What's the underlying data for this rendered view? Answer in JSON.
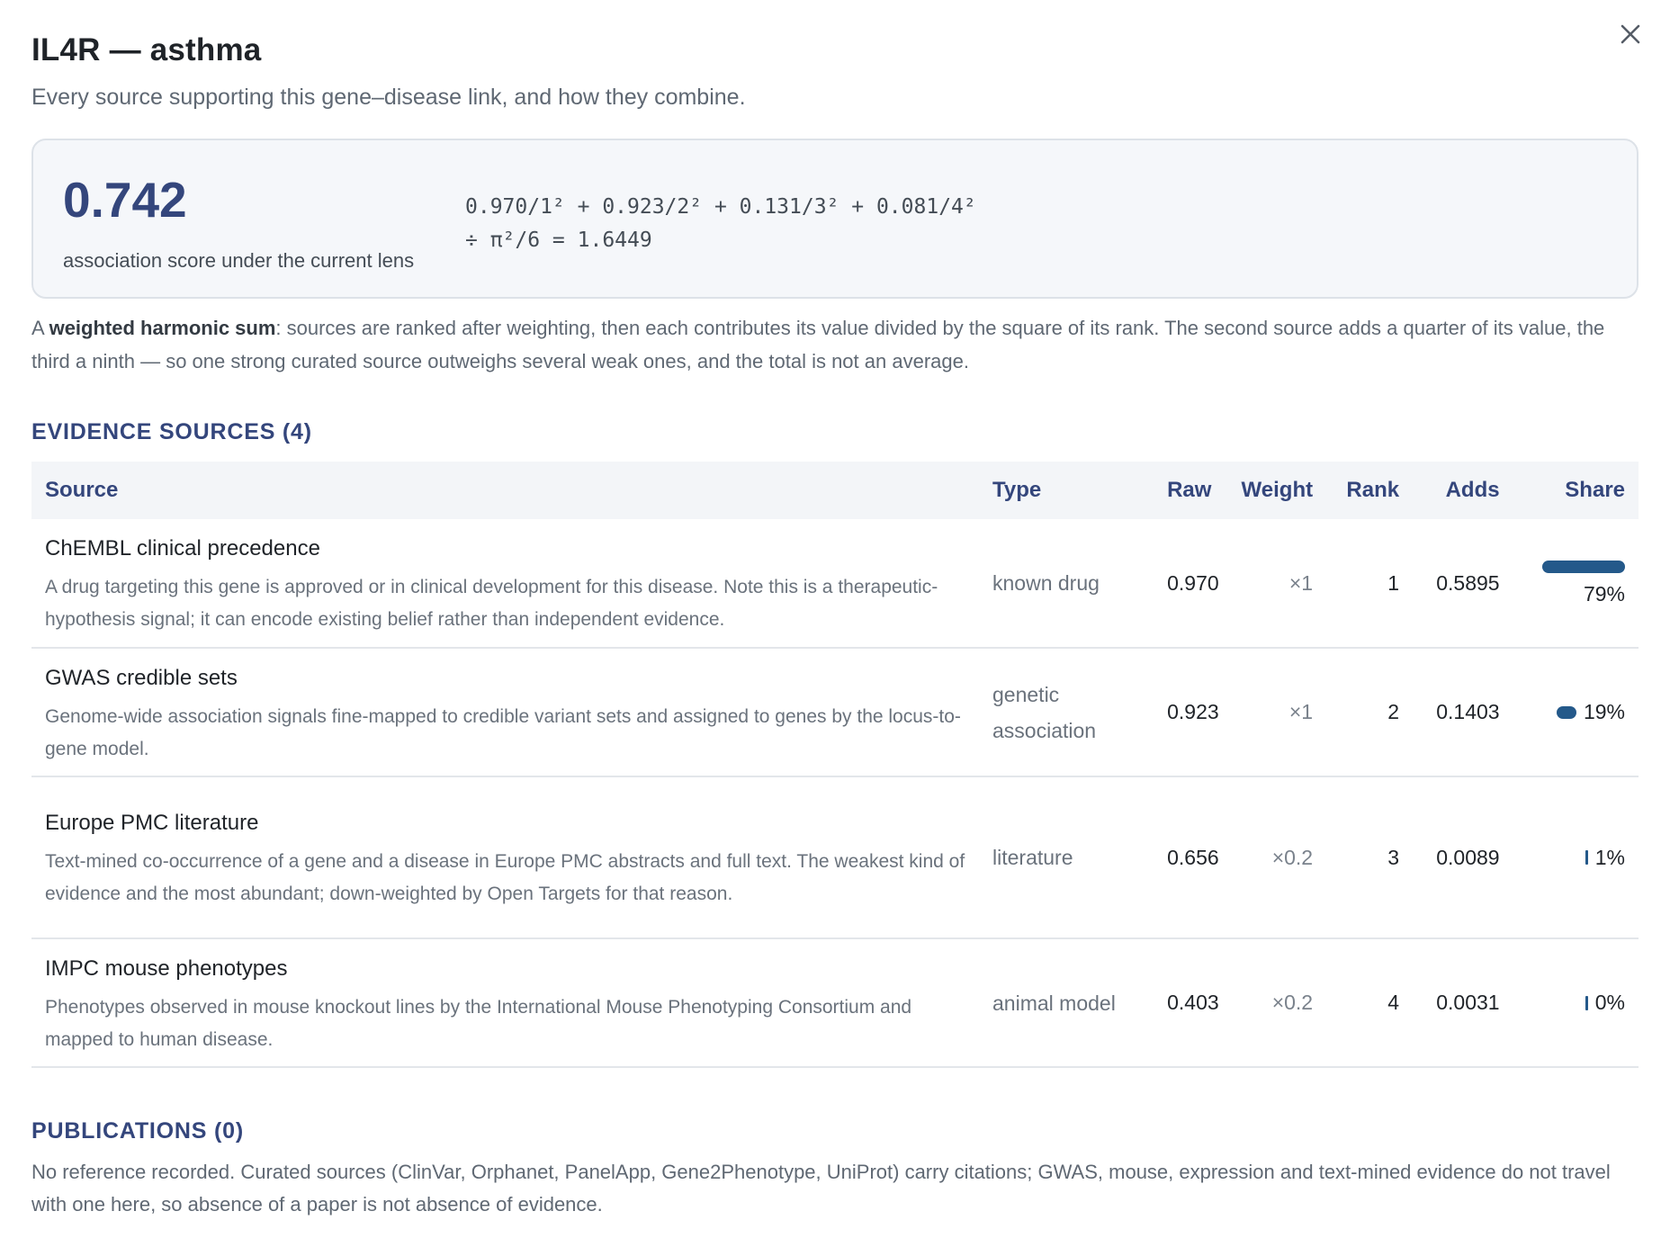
{
  "dialog": {
    "title": "IL4R — asthma",
    "subtitle": "Every source supporting this gene–disease link, and how they combine.",
    "close_icon": "close-icon"
  },
  "score": {
    "value": "0.742",
    "caption": "association score under the current lens",
    "formula_line1": "0.970/1² + 0.923/2² + 0.131/3² + 0.081/4²",
    "formula_line2": "÷ π²/6 = 1.6449"
  },
  "explanation": {
    "prefix": "A ",
    "bold": "weighted harmonic sum",
    "rest": ": sources are ranked after weighting, then each contributes its value divided by the square of its rank. The second source adds a quarter of its value, the third a ninth — so one strong curated source outweighs several weak ones, and the total is not an average."
  },
  "evidence": {
    "heading": "EVIDENCE SOURCES (4)",
    "columns": {
      "source": "Source",
      "type": "Type",
      "raw": "Raw",
      "weight": "Weight",
      "rank": "Rank",
      "adds": "Adds",
      "share": "Share"
    },
    "rows": [
      {
        "name": "ChEMBL clinical precedence",
        "description": "A drug targeting this gene is approved or in clinical development for this disease. Note this is a therapeutic-hypothesis signal; it can encode existing belief rather than independent evidence.",
        "type": "known drug",
        "raw": "0.970",
        "weight": "×1",
        "rank": "1",
        "adds": "0.5895",
        "share": "79%",
        "share_value": 0.79
      },
      {
        "name": "GWAS credible sets",
        "description": "Genome-wide association signals fine-mapped to credible variant sets and assigned to genes by the locus-to-gene model.",
        "type": "genetic association",
        "raw": "0.923",
        "weight": "×1",
        "rank": "2",
        "adds": "0.1403",
        "share": "19%",
        "share_value": 0.19
      },
      {
        "name": "Europe PMC literature",
        "description": "Text-mined co-occurrence of a gene and a disease in Europe PMC abstracts and full text. The weakest kind of evidence and the most abundant; down-weighted by Open Targets for that reason.",
        "type": "literature",
        "raw": "0.656",
        "weight": "×0.2",
        "rank": "3",
        "adds": "0.0089",
        "share": "1%",
        "share_value": 0.01
      },
      {
        "name": "IMPC mouse phenotypes",
        "description": "Phenotypes observed in mouse knockout lines by the International Mouse Phenotyping Consortium and mapped to human disease.",
        "type": "animal model",
        "raw": "0.403",
        "weight": "×0.2",
        "rank": "4",
        "adds": "0.0031",
        "share": "0%",
        "share_value": 0.004
      }
    ]
  },
  "publications": {
    "heading": "PUBLICATIONS (0)",
    "text": "No reference recorded. Curated sources (ClinVar, Orphanet, PanelApp, Gene2Phenotype, UniProt) carry citations; GWAS, mouse, expression and text-mined evidence do not travel with one here, so absence of a paper is not absence of evidence."
  },
  "colors": {
    "accent": "#34467c",
    "bar": "#24598a"
  }
}
